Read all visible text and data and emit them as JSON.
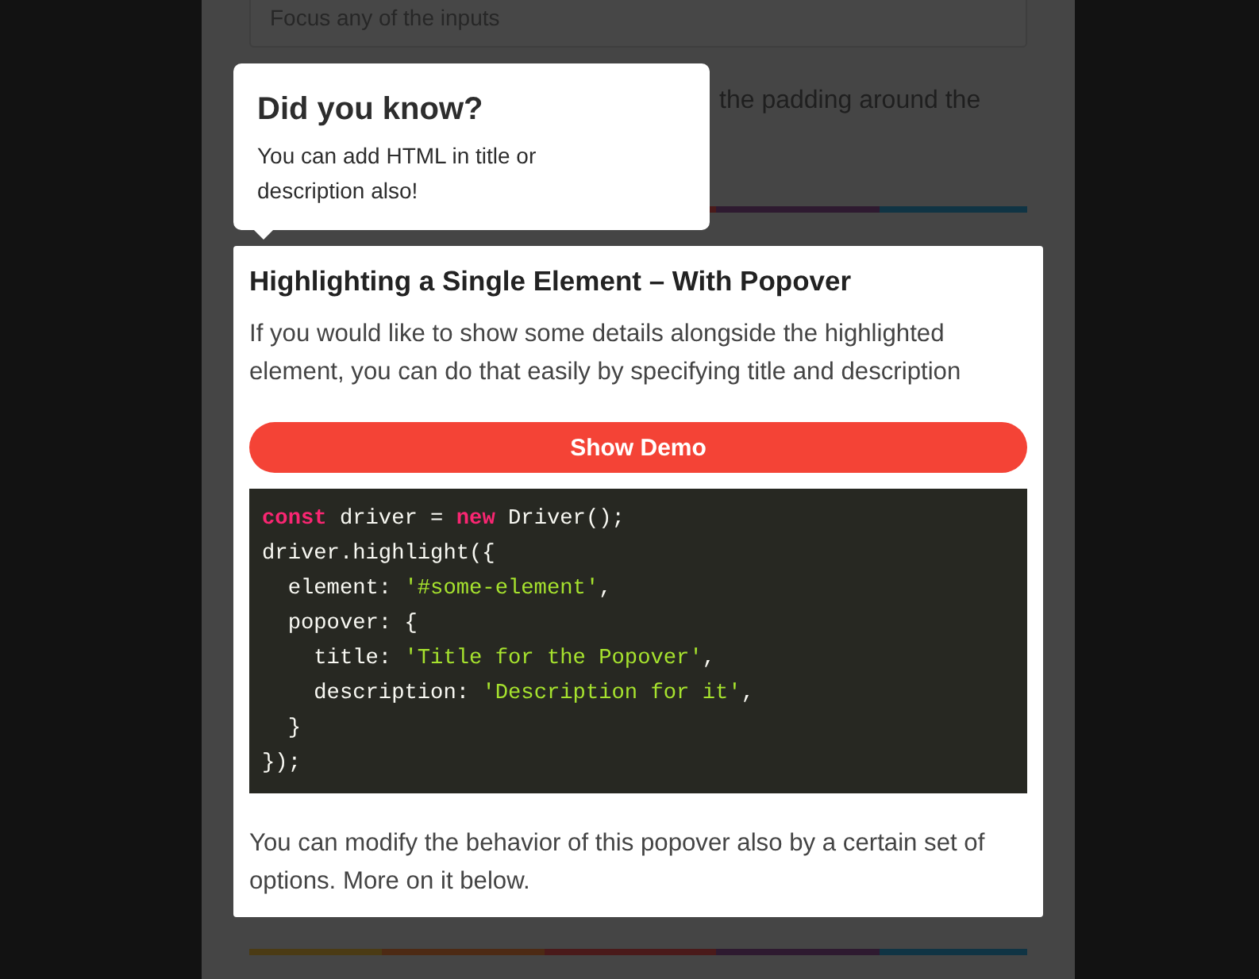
{
  "background_page": {
    "input": {
      "placeholder": "Focus any of the inputs"
    },
    "partial_text": "the padding around the"
  },
  "popover": {
    "title": "Did you know?",
    "description": "You can add HTML in title or description also!"
  },
  "highlighted_section": {
    "title": "Highlighting a Single Element – With Popover",
    "description": "If you would like to show some details alongside the highlighted element, you can do that easily by specifying title and description",
    "button": "Show Demo",
    "code": {
      "lines": [
        {
          "tokens": [
            {
              "kind": "keyword",
              "text": "const"
            },
            {
              "kind": "plain",
              "text": " driver = "
            },
            {
              "kind": "keyword",
              "text": "new"
            },
            {
              "kind": "plain",
              "text": " Driver();"
            }
          ]
        },
        {
          "tokens": [
            {
              "kind": "plain",
              "text": "driver.highlight({"
            }
          ]
        },
        {
          "tokens": [
            {
              "kind": "plain",
              "text": "  element: "
            },
            {
              "kind": "string",
              "text": "'#some-element'"
            },
            {
              "kind": "plain",
              "text": ","
            }
          ]
        },
        {
          "tokens": [
            {
              "kind": "plain",
              "text": "  popover: {"
            }
          ]
        },
        {
          "tokens": [
            {
              "kind": "plain",
              "text": "    title: "
            },
            {
              "kind": "string",
              "text": "'Title for the Popover'"
            },
            {
              "kind": "plain",
              "text": ","
            }
          ]
        },
        {
          "tokens": [
            {
              "kind": "plain",
              "text": "    description: "
            },
            {
              "kind": "string",
              "text": "'Description for it'"
            },
            {
              "kind": "plain",
              "text": ","
            }
          ]
        },
        {
          "tokens": [
            {
              "kind": "plain",
              "text": "  }"
            }
          ]
        },
        {
          "tokens": [
            {
              "kind": "plain",
              "text": "});"
            }
          ]
        }
      ]
    },
    "note": "You can modify the behavior of this popover also by a certain set of options. More on it below."
  }
}
